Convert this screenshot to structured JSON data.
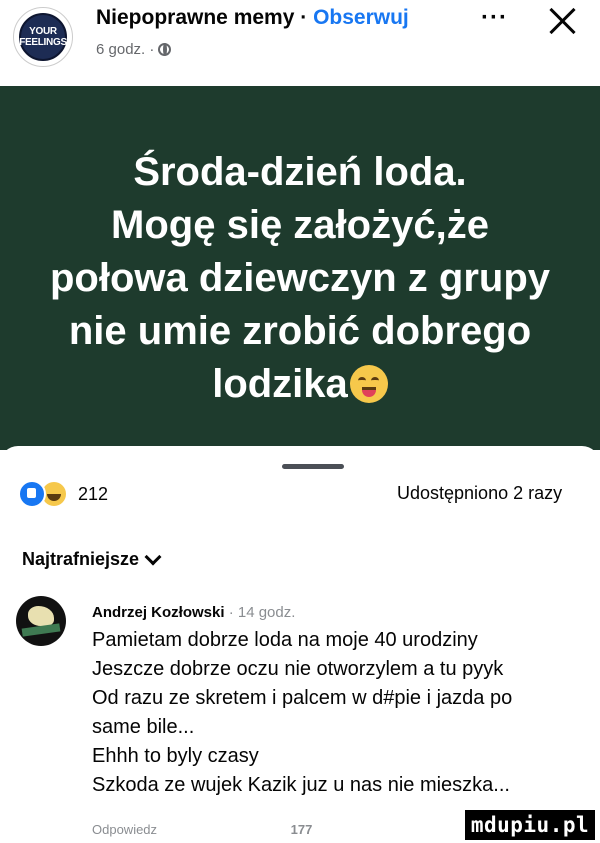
{
  "header": {
    "page_name": "Niepoprawne memy",
    "separator": " · ",
    "follow_label": "Obserwuj",
    "time": "6 godz. ·",
    "avatar_text": [
      "YOUR",
      "FEELINGS"
    ],
    "more_label": "···",
    "icons": {
      "globe": "globe-icon",
      "close": "close-icon"
    }
  },
  "post": {
    "lines": [
      "Środa-dzień loda.",
      "Mogę się założyć,że",
      "połowa dziewczyn z grupy",
      "nie umie zrobić dobrego",
      "lodzika"
    ],
    "background": "#1e3b2d"
  },
  "stats": {
    "reaction_count": "212",
    "shares": "Udostępniono 2 razy",
    "reaction_icons": [
      "like-icon",
      "haha-icon"
    ]
  },
  "comments": {
    "sort_label": "Najtrafniejsze",
    "items": [
      {
        "author": "Andrzej Kozłowski",
        "time": " · 14 godz.",
        "lines": [
          "Pamietam dobrze loda na moje 40 urodziny",
          "Jeszcze dobrze oczu nie otworzylem a tu pyyk",
          "Od razu ze skretem i palcem w d#pie i jazda po",
          "same bile...",
          "Ehhh to byly czasy",
          "Szkoda ze wujek Kazik juz u nas nie mieszka..."
        ],
        "reply_label": "Odpowiedz",
        "likes": "177"
      }
    ]
  },
  "watermark": "mdupiu.pl",
  "colors": {
    "accent": "#1877f2",
    "text": "#050505",
    "muted": "#65676b"
  }
}
